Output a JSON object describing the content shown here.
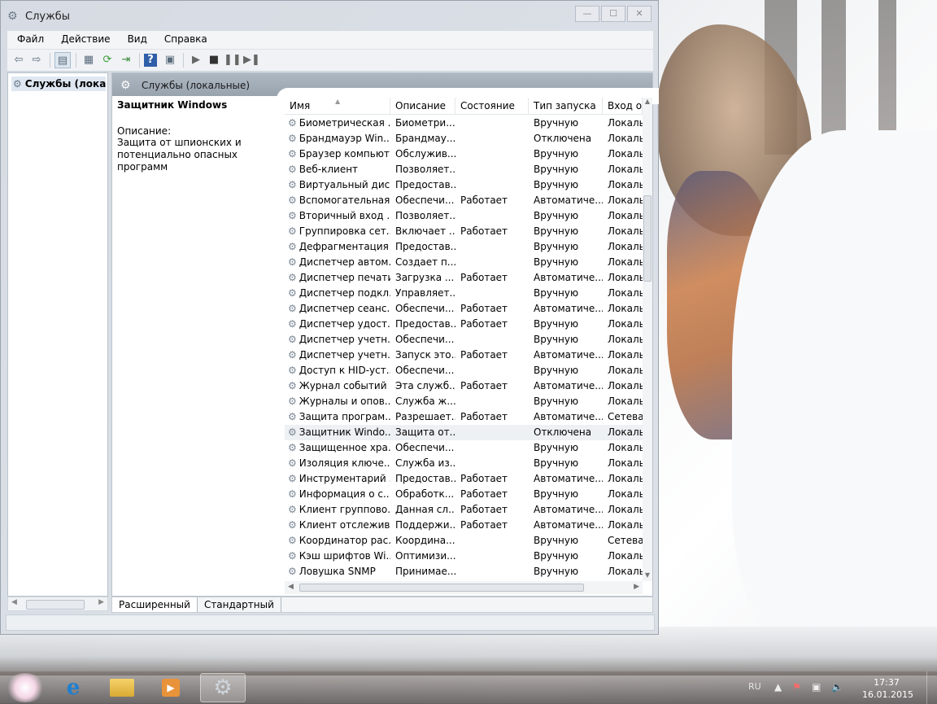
{
  "window": {
    "title": "Службы",
    "caption": {
      "minimize": "—",
      "maximize": "☐",
      "close": "✕"
    }
  },
  "menu": [
    "Файл",
    "Действие",
    "Вид",
    "Справка"
  ],
  "toolbar": {
    "icons": [
      "back-icon",
      "forward-icon",
      "show-hide-console-tree-icon",
      "properties-icon",
      "refresh-icon",
      "export-list-icon",
      "help-icon",
      "show-action-pane-icon",
      "start-service-icon",
      "stop-service-icon",
      "pause-service-icon",
      "restart-service-icon"
    ]
  },
  "tree": {
    "selected_label": "Службы (локаль"
  },
  "right_header": {
    "title": "Службы (локальные)"
  },
  "description": {
    "service_name": "Защитник Windows",
    "label": "Описание:",
    "text": "Защита от шпионских  и потенциально опасных программ"
  },
  "table": {
    "columns": [
      "Имя",
      "Описание",
      "Состояние",
      "Тип запуска",
      "Вход от"
    ],
    "rows": [
      [
        "Биометрическая ...",
        "Биометри...",
        "",
        "Вручную",
        "Локаль"
      ],
      [
        "Брандмауэр Win...",
        "Брандмау...",
        "",
        "Отключена",
        "Локаль"
      ],
      [
        "Браузер компьют...",
        "Обслужив...",
        "",
        "Вручную",
        "Локаль"
      ],
      [
        "Веб-клиент",
        "Позволяет...",
        "",
        "Вручную",
        "Локаль"
      ],
      [
        "Виртуальный диск",
        "Предостав...",
        "",
        "Вручную",
        "Локаль"
      ],
      [
        "Вспомогательная...",
        "Обеспечи...",
        "Работает",
        "Автоматиче...",
        "Локаль"
      ],
      [
        "Вторичный вход ...",
        "Позволяет...",
        "",
        "Вручную",
        "Локаль"
      ],
      [
        "Группировка сет...",
        "Включает ...",
        "Работает",
        "Вручную",
        "Локаль"
      ],
      [
        "Дефрагментация ...",
        "Предостав...",
        "",
        "Вручную",
        "Локаль"
      ],
      [
        "Диспетчер автом...",
        "Создает п...",
        "",
        "Вручную",
        "Локаль"
      ],
      [
        "Диспетчер печати",
        "Загрузка ...",
        "Работает",
        "Автоматиче...",
        "Локаль"
      ],
      [
        "Диспетчер подкл...",
        "Управляет...",
        "",
        "Вручную",
        "Локаль"
      ],
      [
        "Диспетчер сеанс...",
        "Обеспечи...",
        "Работает",
        "Автоматиче...",
        "Локаль"
      ],
      [
        "Диспетчер удост...",
        "Предостав...",
        "Работает",
        "Вручную",
        "Локаль"
      ],
      [
        "Диспетчер учетн...",
        "Обеспечи...",
        "",
        "Вручную",
        "Локаль"
      ],
      [
        "Диспетчер учетн...",
        "Запуск это...",
        "Работает",
        "Автоматиче...",
        "Локаль"
      ],
      [
        "Доступ к HID-уст...",
        "Обеспечи...",
        "",
        "Вручную",
        "Локаль"
      ],
      [
        "Журнал событий ...",
        "Эта служб...",
        "Работает",
        "Автоматиче...",
        "Локаль"
      ],
      [
        "Журналы и опов...",
        "Служба ж...",
        "",
        "Вручную",
        "Локаль"
      ],
      [
        "Защита програм...",
        "Разрешает...",
        "Работает",
        "Автоматиче...",
        "Сетева"
      ],
      [
        "Защитник Windo...",
        "Защита от...",
        "",
        "Отключена",
        "Локаль"
      ],
      [
        "Защищенное хра...",
        "Обеспечи...",
        "",
        "Вручную",
        "Локаль"
      ],
      [
        "Изоляция ключе...",
        "Служба из...",
        "",
        "Вручную",
        "Локаль"
      ],
      [
        "Инструментарий ...",
        "Предостав...",
        "Работает",
        "Автоматиче...",
        "Локаль"
      ],
      [
        "Информация о с...",
        "Обработк...",
        "Работает",
        "Вручную",
        "Локаль"
      ],
      [
        "Клиент группово...",
        "Данная сл...",
        "Работает",
        "Автоматиче...",
        "Локаль"
      ],
      [
        "Клиент отслежив...",
        "Поддержи...",
        "Работает",
        "Автоматиче...",
        "Локаль"
      ],
      [
        "Координатор рас...",
        "Координа...",
        "",
        "Вручную",
        "Сетева"
      ],
      [
        "Кэш шрифтов Wi...",
        "Оптимизи...",
        "",
        "Вручную",
        "Локаль"
      ],
      [
        "Ловушка SNMP",
        "Принимае...",
        "",
        "Вручную",
        "Локаль"
      ]
    ],
    "selected_index": 20
  },
  "tabs": [
    "Расширенный",
    "Стандартный"
  ],
  "taskbar": {
    "language": "RU",
    "time": "17:37",
    "date": "16.01.2015"
  }
}
